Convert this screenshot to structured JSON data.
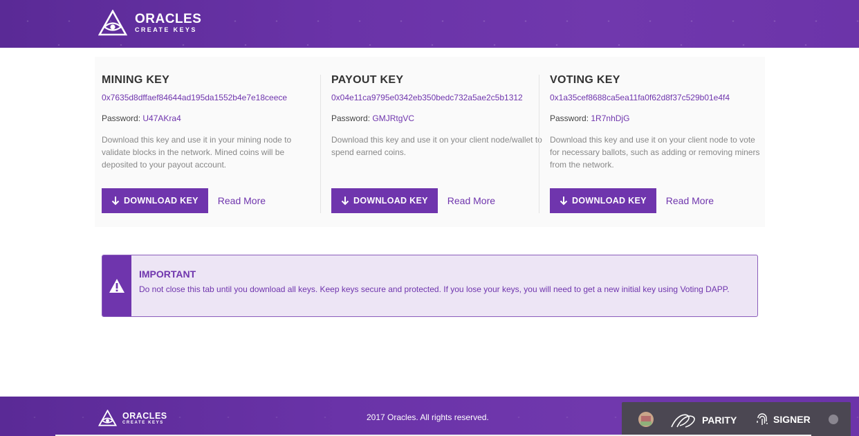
{
  "header": {
    "brand": "ORACLES",
    "subtitle": "CREATE KEYS"
  },
  "keys": [
    {
      "title": "MINING KEY",
      "address": "0x7635d8dffaef84644ad195da1552b4e7e18ceece",
      "password_label": "Password:",
      "password": "U47AKra4",
      "description": "Download this key and use it in your mining node to validate blocks in the network. Mined coins will be deposited to your payout account.",
      "download_label": "DOWNLOAD KEY",
      "read_more": "Read More"
    },
    {
      "title": "PAYOUT KEY",
      "address": "0x04e11ca9795e0342eb350bedc732a5ae2c5b1312",
      "password_label": "Password:",
      "password": "GMJRtgVC",
      "description": "Download this key and use it on your client node/wallet to spend earned coins.",
      "download_label": "DOWNLOAD KEY",
      "read_more": "Read More"
    },
    {
      "title": "VOTING KEY",
      "address": "0x1a35cef8688ca5ea11fa0f62d8f37c529b01e4f4",
      "password_label": "Password:",
      "password": "1R7nhDjG",
      "description": "Download this key and use it on your client node to vote for necessary ballots, such as adding or removing miners from the network.",
      "download_label": "DOWNLOAD KEY",
      "read_more": "Read More"
    }
  ],
  "alert": {
    "title": "IMPORTANT",
    "message": "Do not close this tab until you download all keys. Keep keys secure and protected. If you lose your keys, you will need to get a new initial key using Voting DAPP."
  },
  "footer": {
    "brand": "ORACLES",
    "subtitle": "CREATE KEYS",
    "copyright": "2017 Oracles. All rights reserved."
  },
  "parity_bar": {
    "parity_label": "PARITY",
    "signer_label": "SIGNER"
  },
  "colors": {
    "accent": "#6f35ad",
    "header_bg": "#6a33a8",
    "alert_bg": "#ede5f5"
  },
  "icons": [
    "eye-triangle-logo-icon",
    "download-arrow-icon",
    "warning-icon",
    "parity-logo-icon",
    "fingerprint-icon"
  ]
}
